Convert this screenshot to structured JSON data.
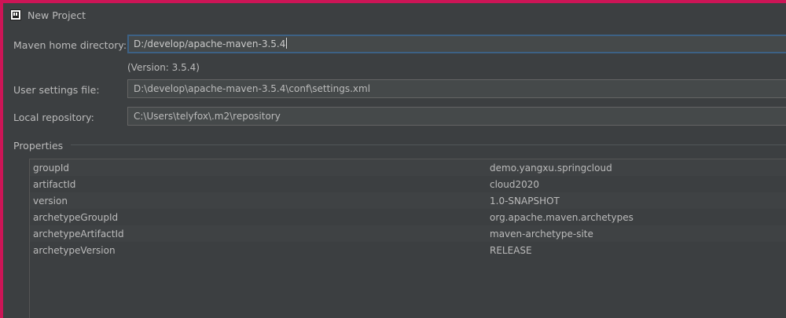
{
  "window": {
    "title": "New Project",
    "icon": "intellij-idea-icon"
  },
  "form": {
    "maven_home": {
      "label": "Maven home directory:",
      "value": "D:/develop/apache-maven-3.5.4"
    },
    "version_note": "(Version: 3.5.4)",
    "user_settings": {
      "label": "User settings file:",
      "value": "D:\\develop\\apache-maven-3.5.4\\conf\\settings.xml"
    },
    "local_repo": {
      "label": "Local repository:",
      "value": "C:\\Users\\telyfox\\.m2\\repository"
    }
  },
  "properties": {
    "title": "Properties",
    "rows": [
      {
        "key": "groupId",
        "value": "demo.yangxu.springcloud"
      },
      {
        "key": "artifactId",
        "value": "cloud2020"
      },
      {
        "key": "version",
        "value": "1.0-SNAPSHOT"
      },
      {
        "key": "archetypeGroupId",
        "value": "org.apache.maven.archetypes"
      },
      {
        "key": "archetypeArtifactId",
        "value": "maven-archetype-site"
      },
      {
        "key": "archetypeVersion",
        "value": "RELEASE"
      }
    ]
  },
  "colors": {
    "background": "#3c3f41",
    "frame_border": "#cc1556",
    "focus_border": "#3d6185",
    "text": "#bbbbbb"
  }
}
